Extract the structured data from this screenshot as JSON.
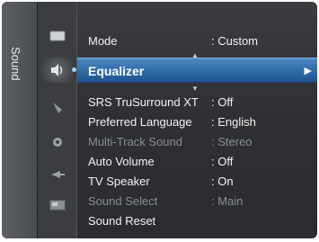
{
  "category": {
    "label": "Sound"
  },
  "icons": [
    {
      "name": "picture-icon"
    },
    {
      "name": "sound-icon"
    },
    {
      "name": "channel-icon"
    },
    {
      "name": "setup-icon"
    },
    {
      "name": "input-icon"
    },
    {
      "name": "application-icon"
    }
  ],
  "menu": {
    "mode": {
      "label": "Mode",
      "value": ": Custom"
    },
    "equalizer": {
      "label": "Equalizer",
      "arrow": "▶"
    },
    "srs": {
      "label": "SRS TruSurround XT",
      "value": ": Off"
    },
    "language": {
      "label": "Preferred Language",
      "value": ": English"
    },
    "multitrack": {
      "label": "Multi-Track Sound",
      "value": ": Stereo"
    },
    "autovolume": {
      "label": "Auto Volume",
      "value": ": Off"
    },
    "tvspeaker": {
      "label": "TV Speaker",
      "value": ": On"
    },
    "soundselect": {
      "label": "Sound Select",
      "value": ": Main"
    },
    "soundreset": {
      "label": "Sound Reset"
    }
  },
  "colors": {
    "highlight": "#2f6aa8",
    "background": "#2e3033",
    "disabled_text": "#8b8e92"
  }
}
